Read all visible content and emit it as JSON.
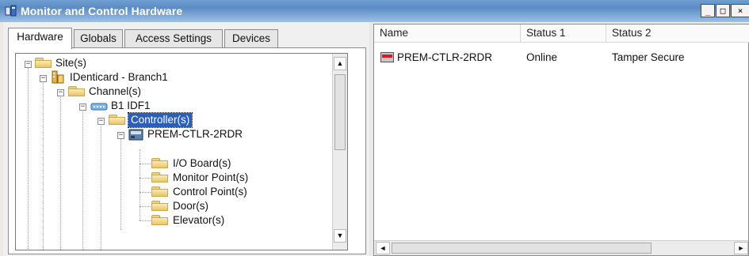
{
  "window": {
    "title": "Monitor and Control Hardware",
    "min_glyph": "_",
    "max_glyph": "□",
    "close_glyph": "×",
    "title_icon": "hardware-app-icon"
  },
  "tabs": [
    {
      "label": "Hardware",
      "active": true
    },
    {
      "label": "Globals",
      "active": false
    },
    {
      "label": "Access Settings",
      "active": false
    },
    {
      "label": "Devices",
      "active": false
    }
  ],
  "tree": {
    "expander_minus": "−",
    "nodes": [
      {
        "label": "Site(s)",
        "icon": "folder-icon"
      },
      {
        "label": "IDenticard - Branch1",
        "icon": "branch-icon"
      },
      {
        "label": "Channel(s)",
        "icon": "folder-icon"
      },
      {
        "label": "B1 IDF1",
        "icon": "network-icon"
      },
      {
        "label": "Controller(s)",
        "icon": "folder-icon",
        "selected": true
      },
      {
        "label": "PREM-CTLR-2RDR",
        "icon": "controller-icon"
      },
      {
        "label": "I/O Board(s)",
        "icon": "folder-icon"
      },
      {
        "label": "Monitor Point(s)",
        "icon": "folder-icon"
      },
      {
        "label": "Control Point(s)",
        "icon": "folder-icon"
      },
      {
        "label": "Door(s)",
        "icon": "folder-icon"
      },
      {
        "label": "Elevator(s)",
        "icon": "folder-icon"
      }
    ]
  },
  "scroll": {
    "up": "▲",
    "down": "▼",
    "left": "◄",
    "right": "►"
  },
  "list": {
    "columns": [
      "Name",
      "Status 1",
      "Status 2"
    ],
    "rows": [
      {
        "name": "PREM-CTLR-2RDR",
        "status1": "Online",
        "status2": "Tamper Secure",
        "icon": "controller-icon"
      }
    ]
  },
  "colors": {
    "selection": "#2b5fb8",
    "status_red": "#d21f1f",
    "folder": "#e7c766"
  }
}
